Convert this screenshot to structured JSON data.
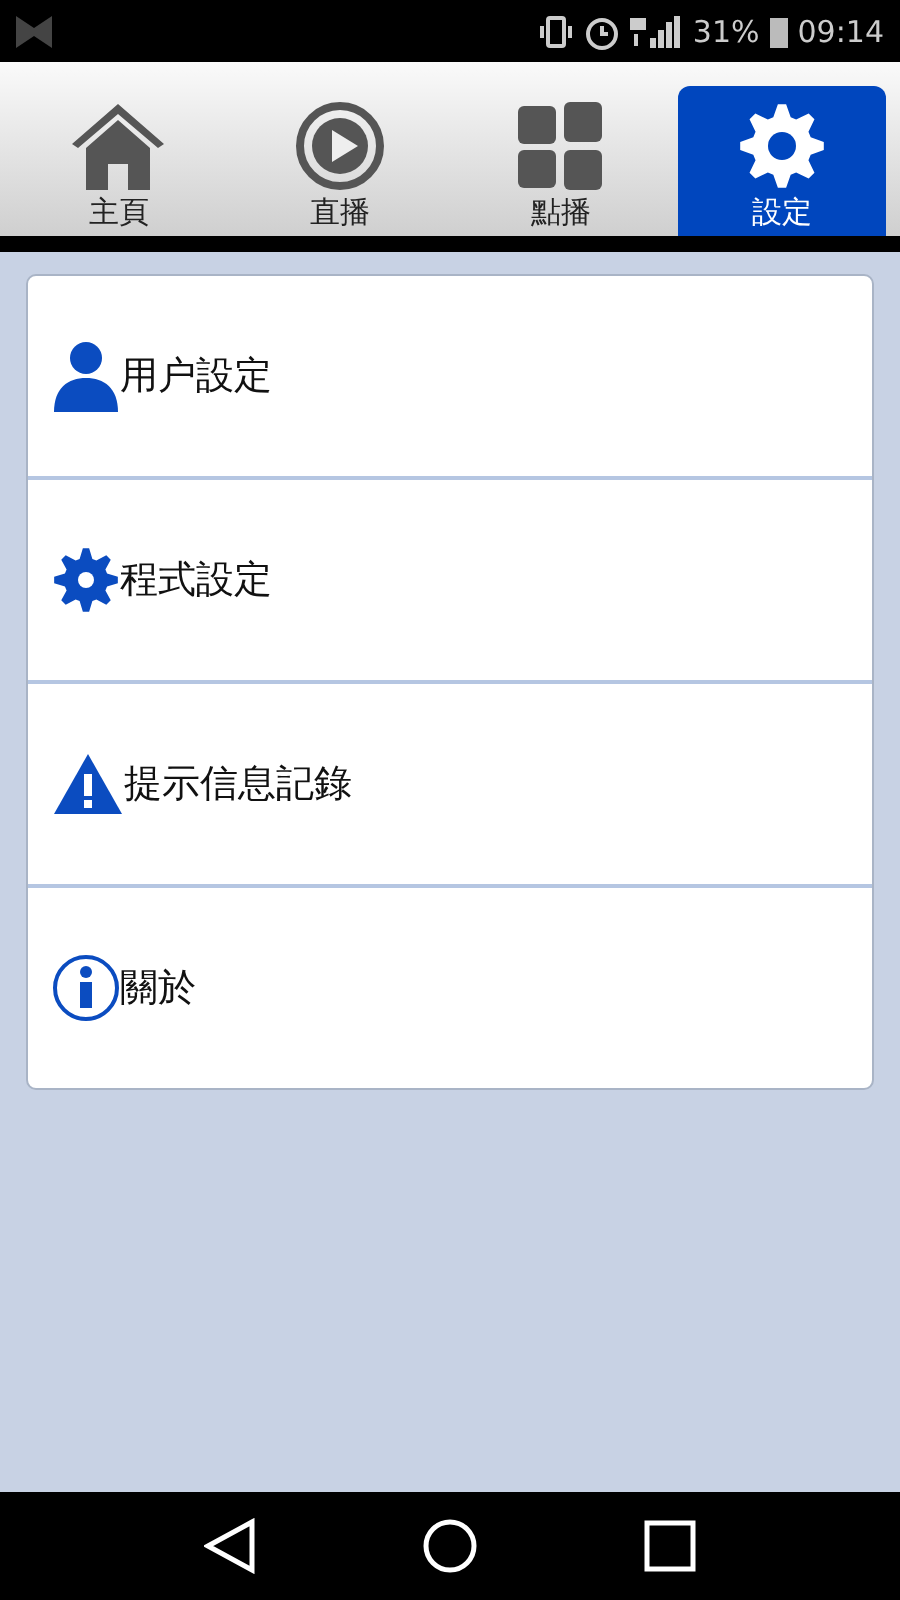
{
  "status_bar": {
    "battery": "31%",
    "time": "09:14"
  },
  "tabs": [
    {
      "label": "主頁",
      "kind": "home",
      "selected": false
    },
    {
      "label": "直播",
      "kind": "play",
      "selected": false
    },
    {
      "label": "點播",
      "kind": "grid",
      "selected": false
    },
    {
      "label": "設定",
      "kind": "gear",
      "selected": true
    }
  ],
  "menu": [
    {
      "label": "用户設定",
      "kind": "user"
    },
    {
      "label": "程式設定",
      "kind": "gear"
    },
    {
      "label": "提示信息記錄",
      "kind": "warning"
    },
    {
      "label": "關於",
      "kind": "info"
    }
  ]
}
